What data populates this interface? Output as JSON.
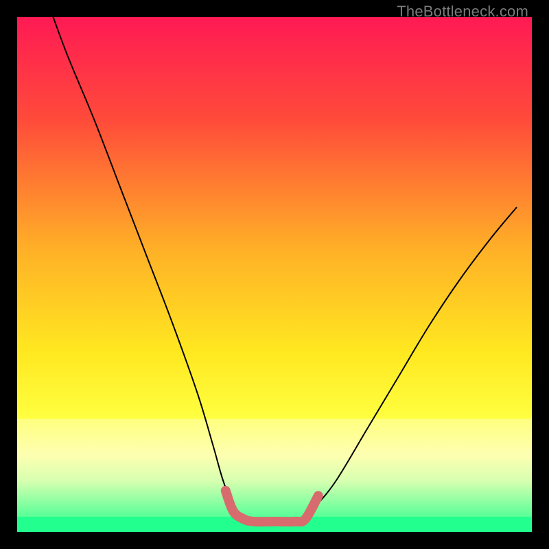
{
  "watermark": "TheBottleneck.com",
  "chart_data": {
    "type": "line",
    "title": "",
    "xlabel": "",
    "ylabel": "",
    "xlim": [
      0,
      100
    ],
    "ylim": [
      0,
      100
    ],
    "gradient_stops": [
      {
        "pct": 0,
        "color": "#ff1a54"
      },
      {
        "pct": 20,
        "color": "#ff4b3a"
      },
      {
        "pct": 45,
        "color": "#ffb027"
      },
      {
        "pct": 65,
        "color": "#ffe820"
      },
      {
        "pct": 78,
        "color": "#ffff40"
      },
      {
        "pct": 85,
        "color": "#fdffb0"
      },
      {
        "pct": 90,
        "color": "#d8ffb0"
      },
      {
        "pct": 100,
        "color": "#23ff8f"
      }
    ],
    "yellow_band": {
      "y_top_pct": 78,
      "y_bottom_pct": 86,
      "color": "#fdffb0"
    },
    "green_band": {
      "y_top_pct": 97,
      "y_bottom_pct": 100,
      "color": "#23ff8f"
    },
    "series": [
      {
        "name": "bottleneck-curve",
        "color": "#000000",
        "width": 2,
        "x": [
          7,
          10,
          15,
          20,
          25,
          30,
          35,
          38,
          40,
          42,
          44,
          46,
          50,
          54,
          56,
          58,
          62,
          68,
          74,
          80,
          86,
          92,
          97
        ],
        "y": [
          100,
          92,
          80,
          67,
          54,
          41,
          27,
          17,
          10,
          5,
          3,
          2,
          2,
          2,
          3,
          5,
          10,
          20,
          30,
          40,
          49,
          57,
          63
        ]
      },
      {
        "name": "highlight-bottom",
        "color": "#d86b6d",
        "width": 14,
        "x": [
          40.5,
          42,
          44,
          46,
          50,
          54,
          56,
          58.5
        ],
        "y": [
          8,
          4,
          2.5,
          2,
          2,
          2,
          2.5,
          7
        ]
      }
    ]
  }
}
